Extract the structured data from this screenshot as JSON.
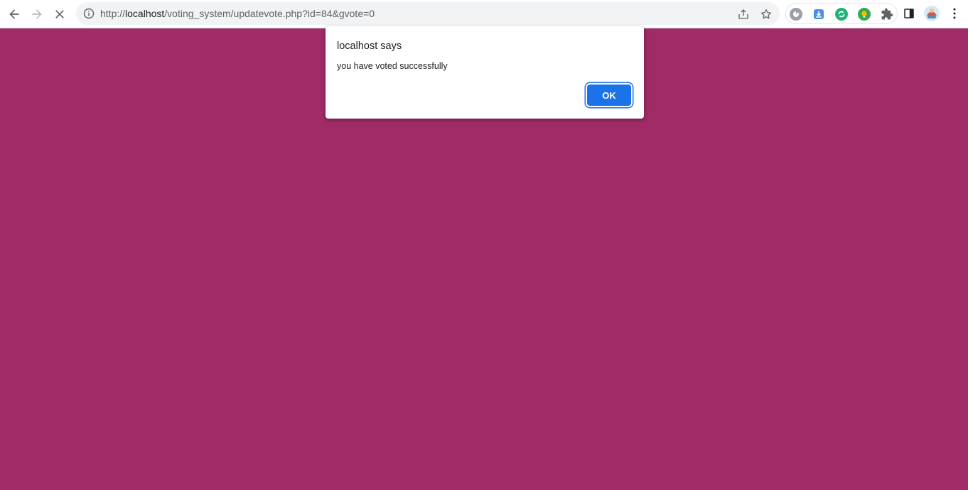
{
  "browser": {
    "url": {
      "scheme": "http://",
      "host": "localhost",
      "path": "/voting_system/updatevote.php?id=84&gvote=0"
    },
    "icons": {
      "back": "arrow-left-icon",
      "forward": "arrow-right-icon",
      "stop": "close-icon",
      "info": "info-icon",
      "share": "share-icon",
      "bookmark": "star-icon",
      "extensions": "puzzle-icon",
      "side_panel": "side-panel-icon",
      "menu": "kebab-menu-icon"
    }
  },
  "dialog": {
    "title": "localhost says",
    "message": "you have voted successfully",
    "ok_label": "OK"
  },
  "colors": {
    "page_background": "#a02b67",
    "accent": "#1a73e8"
  }
}
